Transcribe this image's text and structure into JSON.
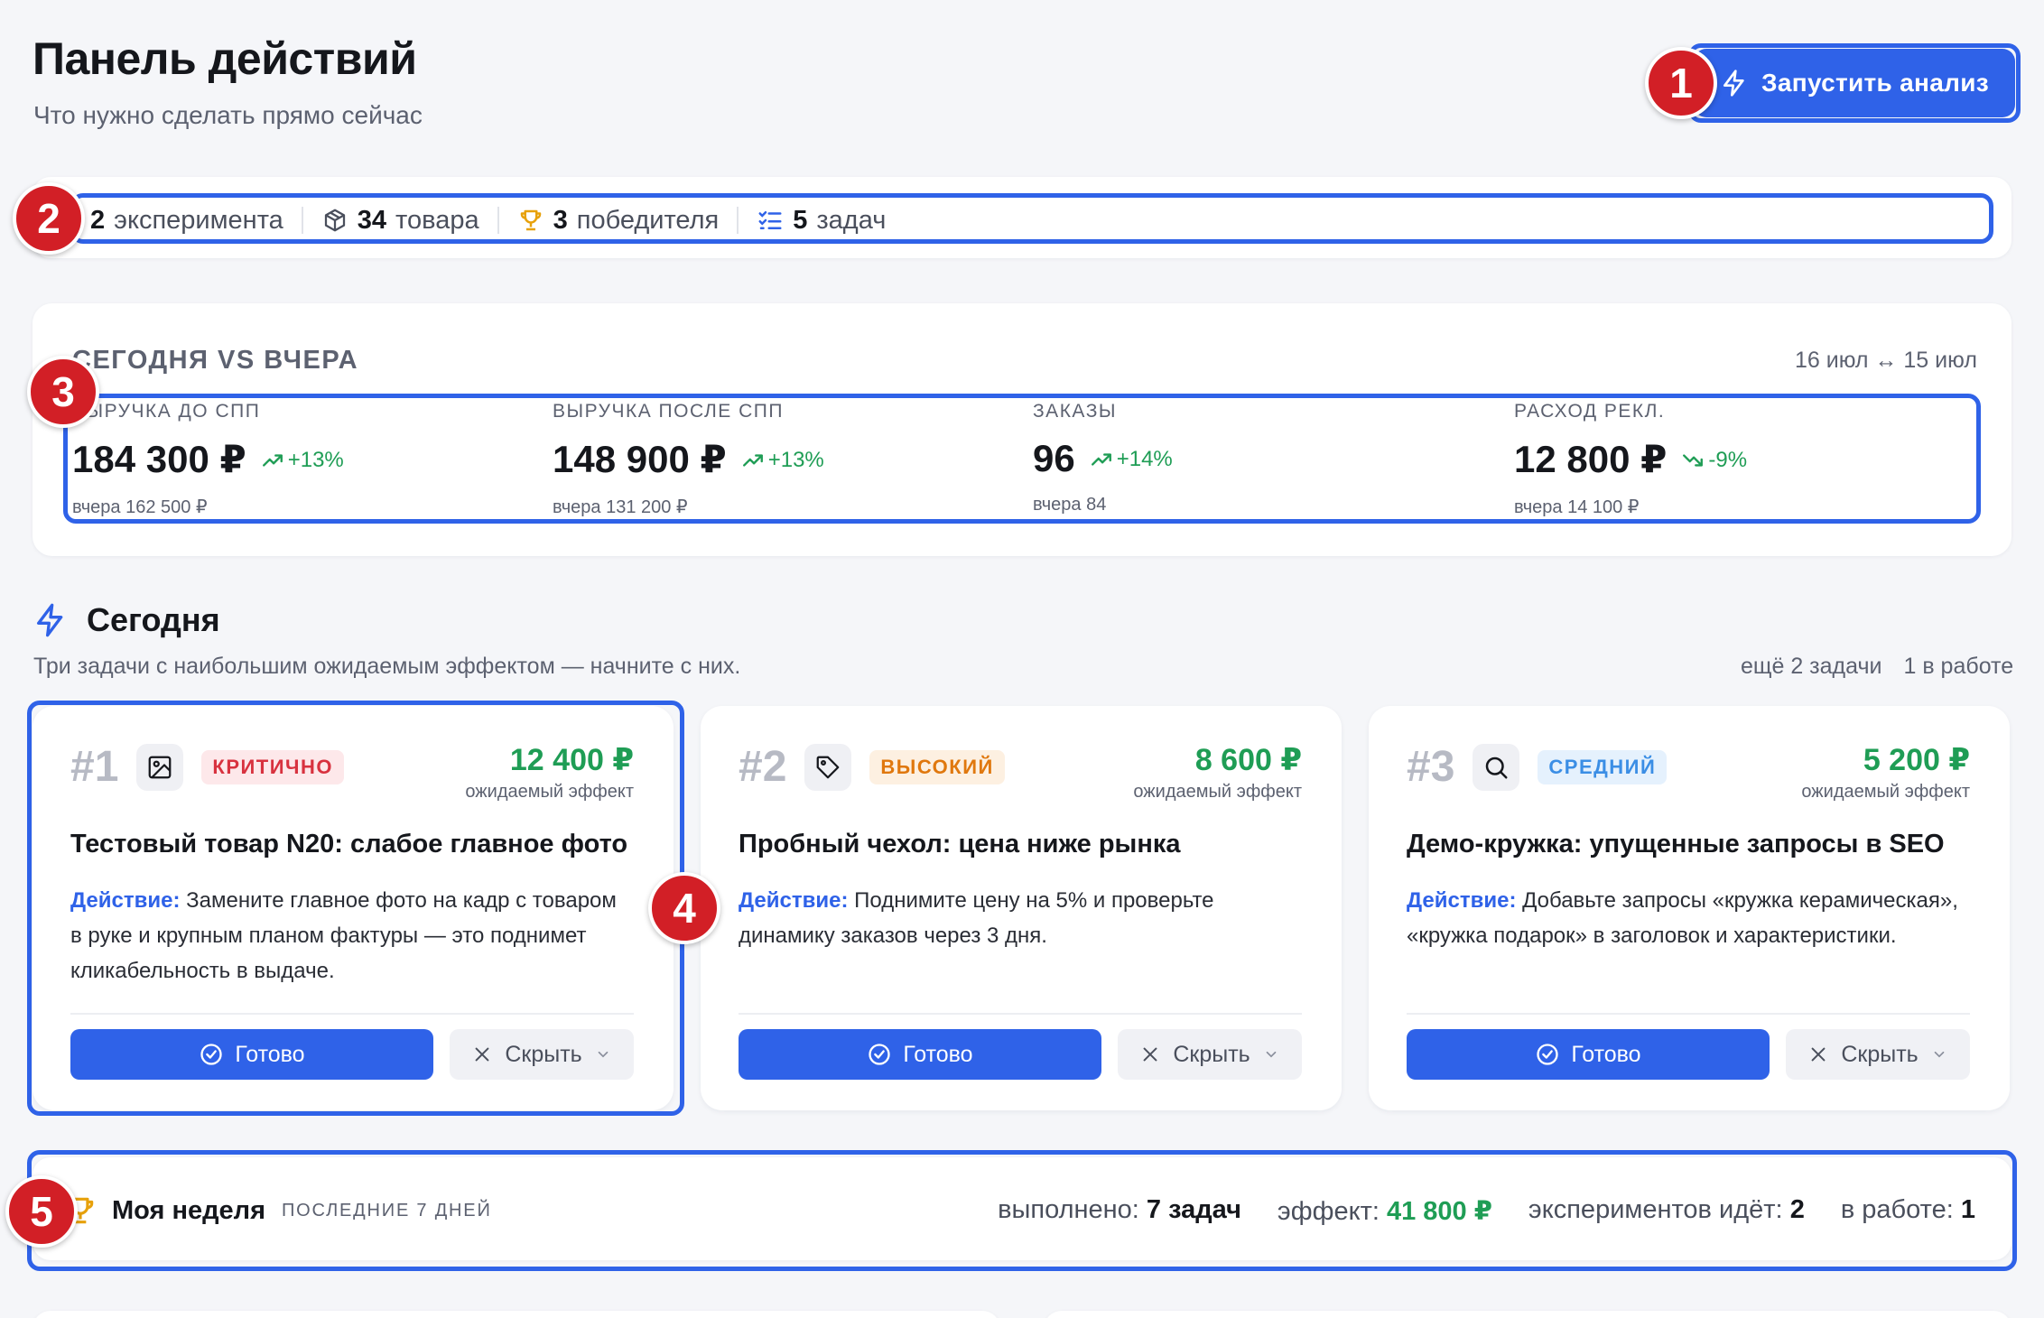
{
  "header": {
    "title": "Панель действий",
    "subtitle": "Что нужно сделать прямо сейчас",
    "run_button": "Запустить анализ"
  },
  "stats": [
    {
      "value": "2",
      "label": "эксперимента",
      "icon": "flask-icon"
    },
    {
      "value": "34",
      "label": "товара",
      "icon": "box-icon"
    },
    {
      "value": "3",
      "label": "победителя",
      "icon": "trophy-icon"
    },
    {
      "value": "5",
      "label": "задач",
      "icon": "checklist-icon"
    }
  ],
  "comparison": {
    "title": "СЕГОДНЯ VS ВЧЕРА",
    "dates": "16 июл ↔ 15 июл",
    "metrics": [
      {
        "label": "ВЫРУЧКА ДО СПП",
        "value": "184 300 ₽",
        "delta": "+13%",
        "trend": "up",
        "prev": "вчера 162 500 ₽"
      },
      {
        "label": "ВЫРУЧКА ПОСЛЕ СПП",
        "value": "148 900 ₽",
        "delta": "+13%",
        "trend": "up",
        "prev": "вчера 131 200 ₽"
      },
      {
        "label": "ЗАКАЗЫ",
        "value": "96",
        "delta": "+14%",
        "trend": "up",
        "prev": "вчера 84"
      },
      {
        "label": "РАСХОД РЕКЛ.",
        "value": "12 800 ₽",
        "delta": "-9%",
        "trend": "down",
        "prev": "вчера 14 100 ₽"
      }
    ]
  },
  "today": {
    "title": "Сегодня",
    "subtitle": "Три задачи с наибольшим ожидаемым эффектом — начните с них.",
    "more": "ещё 2 задачи",
    "in_progress": "1 в работе",
    "tasks": [
      {
        "rank": "#1",
        "icon": "image-icon",
        "priority": "КРИТИЧНО",
        "effect": "12 400 ₽",
        "effect_label": "ожидаемый эффект",
        "title": "Тестовый товар N20: слабое главное фото",
        "action_label": "Действие:",
        "action": "Замените главное фото на кадр с товаром в руке и крупным планом фактуры — это поднимет кликабельность в выдаче.",
        "done": "Готово",
        "hide": "Скрыть"
      },
      {
        "rank": "#2",
        "icon": "tag-icon",
        "priority": "ВЫСОКИЙ",
        "effect": "8 600 ₽",
        "effect_label": "ожидаемый эффект",
        "title": "Пробный чехол: цена ниже рынка",
        "action_label": "Действие:",
        "action": "Поднимите цену на 5% и проверьте динамику заказов через 3 дня.",
        "done": "Готово",
        "hide": "Скрыть"
      },
      {
        "rank": "#3",
        "icon": "search-icon",
        "priority": "СРЕДНИЙ",
        "effect": "5 200 ₽",
        "effect_label": "ожидаемый эффект",
        "title": "Демо-кружка: упущенные запросы в SEO",
        "action_label": "Действие:",
        "action": "Добавьте запросы «кружка керамическая», «кружка подарок» в заголовок и характеристики.",
        "done": "Готово",
        "hide": "Скрыть"
      }
    ]
  },
  "week": {
    "title": "Моя неделя",
    "period": "ПОСЛЕДНИЕ 7 ДНЕЙ",
    "done_label": "выполнено:",
    "done_value": "7 задач",
    "effect_label": "эффект:",
    "effect_value": "41 800 ₽",
    "experiments_label": "экспериментов идёт:",
    "experiments_value": "2",
    "in_progress_label": "в работе:",
    "in_progress_value": "1"
  },
  "callouts": [
    "1",
    "2",
    "3",
    "4",
    "5"
  ],
  "colors": {
    "accent": "#2f62e8",
    "positive": "#1f9d55",
    "callout": "#d21f26",
    "background": "#f5f6f9"
  }
}
